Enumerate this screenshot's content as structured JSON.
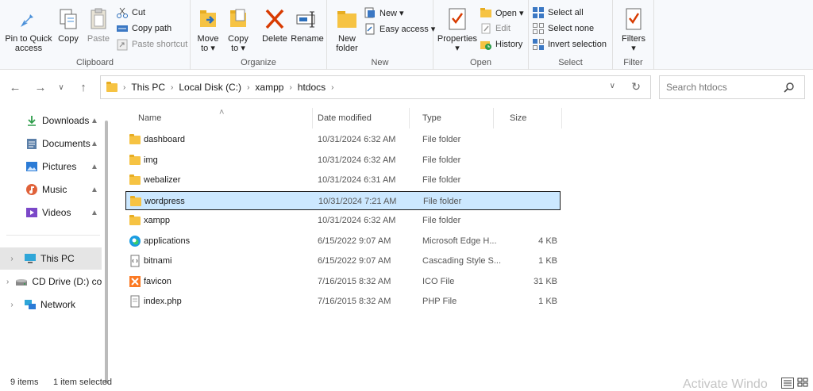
{
  "ribbon": {
    "clipboard": {
      "label": "Clipboard",
      "pin_label_1": "Pin to Quick",
      "pin_label_2": "access",
      "copy": "Copy",
      "paste": "Paste",
      "cut": "Cut",
      "copy_path": "Copy path",
      "paste_shortcut": "Paste shortcut"
    },
    "organize": {
      "label": "Organize",
      "move_1": "Move",
      "move_2": "to ▾",
      "copy_1": "Copy",
      "copy_2": "to ▾",
      "delete": "Delete",
      "rename": "Rename"
    },
    "new": {
      "label": "New",
      "folder_1": "New",
      "folder_2": "folder",
      "new_item": "New ▾",
      "easy_access": "Easy access ▾"
    },
    "open": {
      "label": "Open",
      "properties": "Properties",
      "properties_arrow": "▾",
      "open": "Open ▾",
      "edit": "Edit",
      "history": "History"
    },
    "select": {
      "label": "Select",
      "select_all": "Select all",
      "select_none": "Select none",
      "invert": "Invert selection"
    },
    "filter": {
      "label": "Filter",
      "filters": "Filters",
      "filters_arrow": "▾"
    }
  },
  "nav": {
    "back": "←",
    "forward": "→",
    "recent": "∨",
    "up": "↑",
    "breadcrumbs": [
      "This PC",
      "Local Disk (C:)",
      "xampp",
      "htdocs"
    ],
    "sep": "›",
    "dropdown": "∨",
    "refresh": "↻",
    "search_placeholder": "Search htdocs"
  },
  "sidebar": {
    "quick": [
      {
        "label": "Downloads",
        "icon": "download-icon"
      },
      {
        "label": "Documents",
        "icon": "documents-icon"
      },
      {
        "label": "Pictures",
        "icon": "pictures-icon"
      },
      {
        "label": "Music",
        "icon": "music-icon"
      },
      {
        "label": "Videos",
        "icon": "videos-icon"
      }
    ],
    "pin_glyph": "📌",
    "roots": [
      {
        "label": "This PC",
        "icon": "computer-icon"
      },
      {
        "label": "CD Drive (D:) co",
        "icon": "cd-drive-icon"
      },
      {
        "label": "Network",
        "icon": "network-icon"
      }
    ],
    "chevron": "›"
  },
  "columns": {
    "name": "Name",
    "date": "Date modified",
    "type": "Type",
    "size": "Size",
    "sort_glyph": "˄"
  },
  "files": [
    {
      "name": "dashboard",
      "date": "10/31/2024 6:32 AM",
      "type": "File folder",
      "size": "",
      "icon": "folder-icon"
    },
    {
      "name": "img",
      "date": "10/31/2024 6:32 AM",
      "type": "File folder",
      "size": "",
      "icon": "folder-icon"
    },
    {
      "name": "webalizer",
      "date": "10/31/2024 6:31 AM",
      "type": "File folder",
      "size": "",
      "icon": "folder-icon"
    },
    {
      "name": "wordpress",
      "date": "10/31/2024 7:21 AM",
      "type": "File folder",
      "size": "",
      "icon": "folder-icon"
    },
    {
      "name": "xampp",
      "date": "10/31/2024 6:32 AM",
      "type": "File folder",
      "size": "",
      "icon": "folder-icon"
    },
    {
      "name": "applications",
      "date": "6/15/2022 9:07 AM",
      "type": "Microsoft Edge H...",
      "size": "4 KB",
      "icon": "edge-icon"
    },
    {
      "name": "bitnami",
      "date": "6/15/2022 9:07 AM",
      "type": "Cascading Style S...",
      "size": "1 KB",
      "icon": "css-file-icon"
    },
    {
      "name": "favicon",
      "date": "7/16/2015 8:32 AM",
      "type": "ICO File",
      "size": "31 KB",
      "icon": "xampp-icon"
    },
    {
      "name": "index.php",
      "date": "7/16/2015 8:32 AM",
      "type": "PHP File",
      "size": "1 KB",
      "icon": "php-file-icon"
    }
  ],
  "status": {
    "count": "9 items",
    "selected": "1 item selected"
  },
  "watermark": "Activate Windo",
  "colors": {
    "accent": "#0078d4",
    "selection": "#cce8ff",
    "folder": "#f6c343",
    "delete": "#d83b01"
  }
}
